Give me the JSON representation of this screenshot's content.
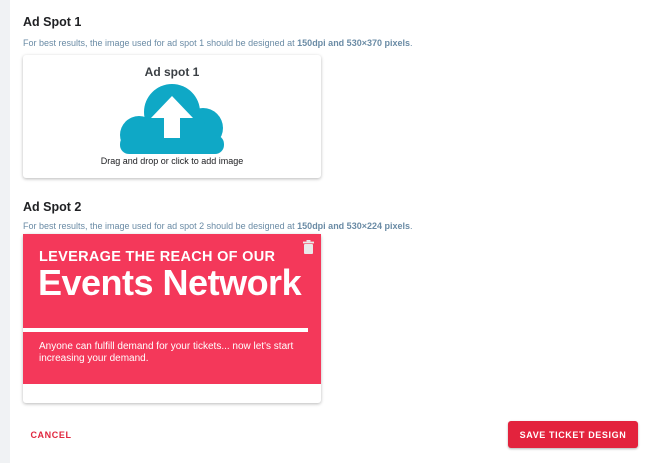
{
  "ad_spot_1": {
    "title": "Ad Spot 1",
    "hint_prefix": "For best results, the image used for ad spot 1 should be designed at ",
    "hint_spec": "150dpi and 530×370 pixels",
    "hint_suffix": ".",
    "dropzone_title": "Ad spot 1",
    "dropzone_text": "Drag and drop or click to add image",
    "icon": "cloud-upload-icon",
    "icon_color": "#0fa8c6"
  },
  "ad_spot_2": {
    "title": "Ad Spot 2",
    "hint_prefix": "For best results, the image used for ad spot 2 should be designed at ",
    "hint_spec": "150dpi and 530×224 pixels",
    "hint_suffix": ".",
    "banner": {
      "line1": "LEVERAGE THE REACH OF OUR",
      "line2": "Events Network",
      "line3": "Anyone can fulfill demand for your tickets... now let's start increasing your demand.",
      "background_color": "#f4385a"
    },
    "delete_icon": "trash-icon"
  },
  "footer": {
    "cancel_label": "CANCEL",
    "save_label": "SAVE TICKET DESIGN",
    "accent_color": "#e3233d"
  }
}
